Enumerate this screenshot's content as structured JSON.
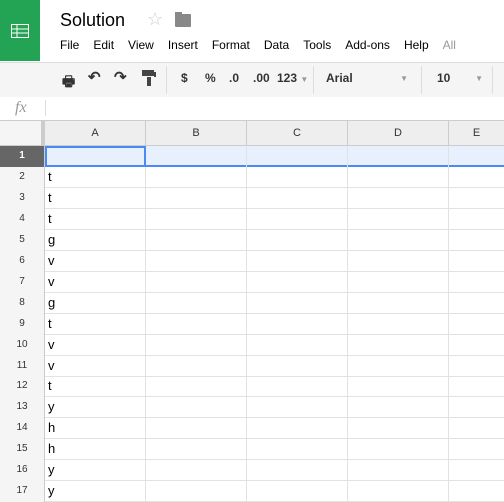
{
  "app": {
    "title": "Solution",
    "logo": "sheets-logo",
    "accent": "#23a455"
  },
  "menu": [
    "File",
    "Edit",
    "View",
    "Insert",
    "Format",
    "Data",
    "Tools",
    "Add-ons",
    "Help",
    "All"
  ],
  "toolbar": {
    "currency": "$",
    "percent": "%",
    "dec_decrease": ".0",
    "dec_increase": ".00",
    "format": "123",
    "font": "Arial",
    "font_size": "10"
  },
  "formula_bar": {
    "label": "fx",
    "value": ""
  },
  "columns": [
    "A",
    "B",
    "C",
    "D",
    "E"
  ],
  "rows": [
    {
      "n": "1",
      "a": ""
    },
    {
      "n": "2",
      "a": "t"
    },
    {
      "n": "3",
      "a": "t"
    },
    {
      "n": "4",
      "a": "t"
    },
    {
      "n": "5",
      "a": "g"
    },
    {
      "n": "6",
      "a": "v"
    },
    {
      "n": "7",
      "a": "v"
    },
    {
      "n": "8",
      "a": "g"
    },
    {
      "n": "9",
      "a": "t"
    },
    {
      "n": "10",
      "a": "v"
    },
    {
      "n": "11",
      "a": "v"
    },
    {
      "n": "12",
      "a": "t"
    },
    {
      "n": "13",
      "a": "y"
    },
    {
      "n": "14",
      "a": "h"
    },
    {
      "n": "15",
      "a": "h"
    },
    {
      "n": "16",
      "a": "y"
    },
    {
      "n": "17",
      "a": "y"
    }
  ],
  "selection": {
    "cell": "A1",
    "color": "#4a8af4"
  }
}
